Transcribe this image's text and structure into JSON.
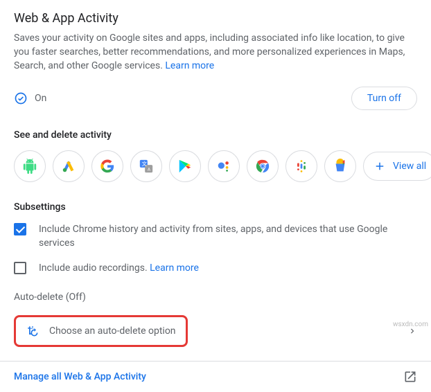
{
  "header": {
    "title": "Web & App Activity",
    "description_part1": "Saves your activity on Google sites and apps, including associated info like location, to give you faster searches, better recommendations, and more personalized experiences in Maps, Search, and other Google services. ",
    "learn_more": "Learn more"
  },
  "status": {
    "state": "On",
    "turn_off_label": "Turn off"
  },
  "activity": {
    "heading": "See and delete activity",
    "view_all_label": "View all",
    "icons": [
      "android-icon",
      "google-ads-icon",
      "google-search-icon",
      "google-translate-icon",
      "google-play-icon",
      "google-assistant-icon",
      "chrome-icon",
      "google-podcasts-icon",
      "google-shopping-icon"
    ]
  },
  "subsettings": {
    "heading": "Subsettings",
    "items": [
      {
        "label": "Include Chrome history and activity from sites, apps, and devices that use Google services",
        "checked": true
      },
      {
        "label": "Include audio recordings. ",
        "learn_more": "Learn more",
        "checked": false
      }
    ]
  },
  "auto_delete": {
    "heading": "Auto-delete (Off)",
    "option_label": "Choose an auto-delete option"
  },
  "footer": {
    "manage_label": "Manage all Web & App Activity"
  },
  "watermark": "wsxdn.com"
}
